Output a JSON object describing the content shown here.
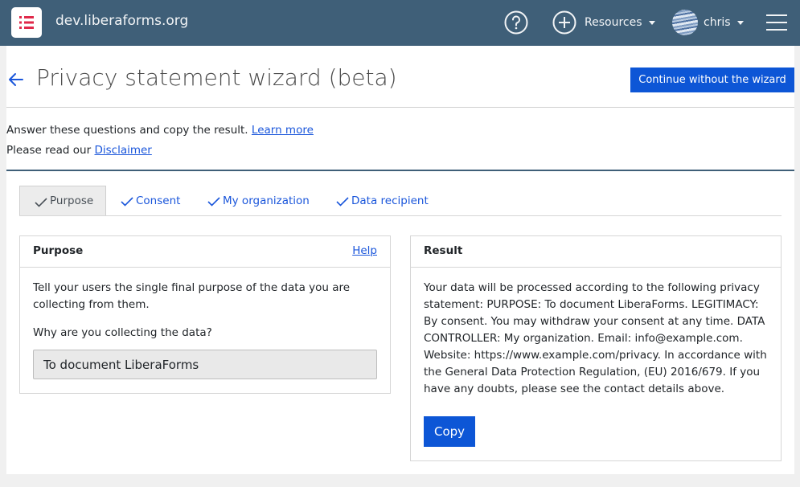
{
  "navbar": {
    "site_name": "dev.liberaforms.org",
    "resources_label": "Resources",
    "user_label": "chris",
    "colors": {
      "background": "#3f5f78",
      "text": "#f2f4f6"
    },
    "icons": [
      "list-logo-icon",
      "help-icon",
      "plus-circle-icon",
      "avatar",
      "hamburger-menu-icon"
    ]
  },
  "header": {
    "title": "Privacy statement wizard (beta)",
    "continue_button": "Continue without the wizard"
  },
  "intro": {
    "line1_text": "Answer these questions and copy the result.",
    "line1_link": "Learn more",
    "line2_text": "Please read our",
    "line2_link": "Disclaimer"
  },
  "tabs": [
    {
      "label": "Purpose",
      "active": true
    },
    {
      "label": "Consent",
      "active": false
    },
    {
      "label": "My organization",
      "active": false
    },
    {
      "label": "Data recipient",
      "active": false
    }
  ],
  "purpose_card": {
    "title": "Purpose",
    "help_link": "Help",
    "description": "Tell your users the single final purpose of the data you are collecting from them.",
    "question": "Why are you collecting the data?",
    "input_value": "To document LiberaForms"
  },
  "result_card": {
    "title": "Result",
    "text": "Your data will be processed according to the following privacy statement: PURPOSE: To document LiberaForms. LEGITIMACY: By consent. You may withdraw your consent at any time. DATA CONTROLLER: My organization. Email: info@example.com. Website: https://www.example.com/privacy. In accordance with the General Data Protection Regulation, (EU) 2016/679. If you have any doubts, please see the contact details above.",
    "copy_button": "Copy"
  },
  "colors": {
    "primary": "#0d56d6",
    "link": "#1a56db"
  }
}
